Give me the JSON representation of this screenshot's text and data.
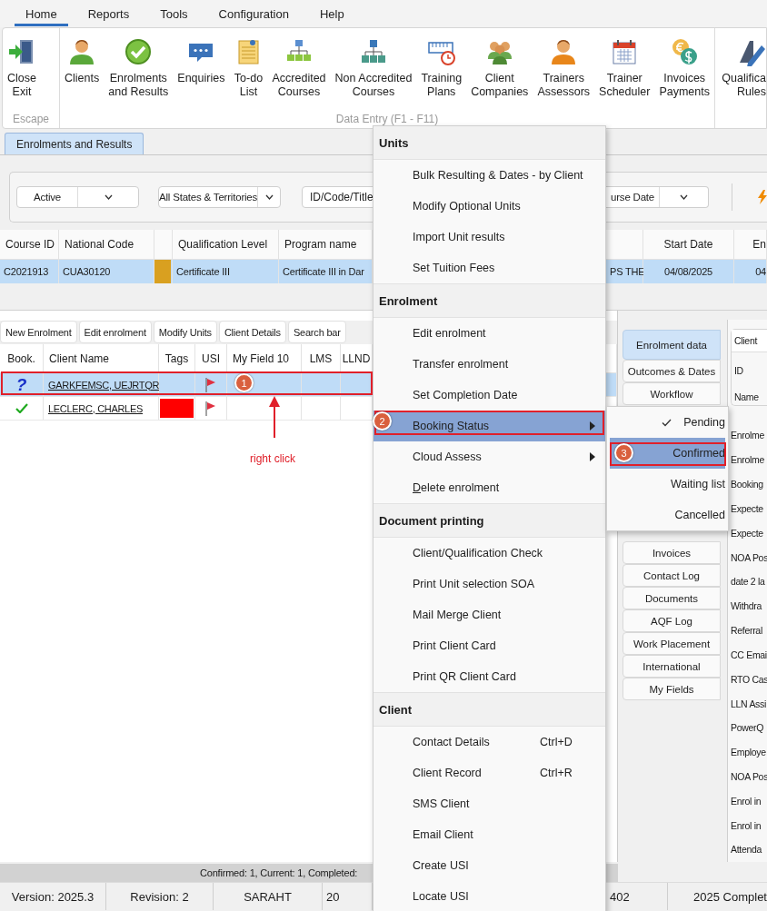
{
  "menu_bar": [
    {
      "label": "Home",
      "selected": true
    },
    {
      "label": "Reports",
      "selected": false
    },
    {
      "label": "Tools",
      "selected": false
    },
    {
      "label": "Configuration",
      "selected": false
    },
    {
      "label": "Help",
      "selected": false
    }
  ],
  "ribbon": {
    "groups": [
      {
        "label": "Escape",
        "buttons": [
          "Close\nExit"
        ]
      },
      {
        "label": "Data Entry (F1 - F11)",
        "buttons": [
          "Clients",
          "Enrolments\nand Results",
          "Enquiries",
          "To-do\nList",
          "Accredited\nCourses",
          "Non Accredited\nCourses",
          "Training\nPlans",
          "Client\nCompanies",
          "Trainers\nAssessors",
          "Trainer\nScheduler",
          "Invoices\nPayments"
        ]
      },
      {
        "buttons": [
          "Qualifica\nRules"
        ]
      }
    ]
  },
  "document_tabs": [
    {
      "label": "Enrolments and Results",
      "selected": true
    }
  ],
  "filters": {
    "status": "Active",
    "states": "All States & Territories",
    "placeholder": "ID/Code/Title",
    "date_sort": "urse Date"
  },
  "course_grid": {
    "columns": [
      "Course ID",
      "National Code",
      "Qualification Level",
      "Program name",
      "Start Date",
      "En"
    ],
    "rows": [
      {
        "course_id": "C2021913",
        "national_code": "CUA30120",
        "color": "#d9a020",
        "qualification_level": "Certificate III",
        "program_name": "Certificate III in Dar",
        "column_7": "PS THE",
        "start_date": "04/08/2025",
        "column_9": "04",
        "selected": true
      }
    ]
  },
  "enrolments": {
    "toolbar": [
      "New Enrolment",
      "Edit enrolment",
      "Modify Units",
      "Client Details",
      "Search bar"
    ],
    "columns": [
      "Book.",
      "Client Name",
      "Tags",
      "USI",
      "My Field 10",
      "LMS",
      "LLND"
    ],
    "rows": [
      {
        "kind": "pending",
        "book": "?",
        "client_name": "GARKFEMSC, UEJRTQR",
        "usi_flag": true,
        "selected": true
      },
      {
        "kind": "confirmed",
        "client_name": "LECLERC, CHARLES",
        "color": "#ff0000",
        "usi_flag": true,
        "selected": false
      }
    ]
  },
  "side_tabs": [
    {
      "label": "Enrolment data",
      "selected": true
    },
    {
      "label": "Outcomes & Dates",
      "selected": false
    },
    {
      "label": "Workflow",
      "selected": false
    },
    {
      "label": "Invoices",
      "selected": false
    },
    {
      "label": "Contact Log",
      "selected": false
    },
    {
      "label": "Documents",
      "selected": false
    },
    {
      "label": "AQF Log",
      "selected": false
    },
    {
      "label": "Work Placement",
      "selected": false
    },
    {
      "label": "International",
      "selected": false
    },
    {
      "label": "My Fields",
      "selected": false
    }
  ],
  "details": {
    "group_title": "Client",
    "group_labels": [
      "ID",
      "Name"
    ],
    "labels": [
      "Enrolme",
      "Enrolme",
      "Booking",
      "Expecte",
      "Expecte",
      "NOA Pos",
      "date 2 la",
      "Withdra",
      "Referral",
      "CC Emai",
      "RTO Cas",
      "LLN Assi",
      "PowerQ",
      "Employe",
      "NOA Pos",
      "Enrol in",
      "Enrol in",
      "Attenda"
    ]
  },
  "summary": "Confirmed: 1, Current: 1, Completed:",
  "status_bar": [
    "Version: 2025.3",
    "Revision: 2",
    "SARAHT",
    "20",
    "402",
    "2025 Complet"
  ],
  "context_menu": {
    "sections": [
      {
        "title": "Units",
        "items": [
          {
            "label": "Bulk Resulting & Dates - by Client",
            "has_submenu": false,
            "selected": false
          },
          {
            "label": "Modify Optional Units",
            "has_submenu": false,
            "selected": false
          },
          {
            "label": "Import Unit results",
            "has_submenu": false,
            "selected": false
          },
          {
            "label": "Set Tuition Fees",
            "has_submenu": false,
            "selected": false
          }
        ]
      },
      {
        "title": "Enrolment",
        "items": [
          {
            "label": "Edit enrolment",
            "has_submenu": false,
            "selected": false
          },
          {
            "label": "Transfer enrolment",
            "has_submenu": false,
            "selected": false
          },
          {
            "label": "Set Completion Date",
            "has_submenu": false,
            "selected": false
          },
          {
            "label": "Booking Status",
            "has_submenu": true,
            "selected": true
          },
          {
            "label": "Cloud Assess",
            "has_submenu": true,
            "selected": false
          },
          {
            "label": "Delete enrolment",
            "has_submenu": false,
            "selected": false,
            "mnemonic": true
          }
        ]
      },
      {
        "title": "Document printing",
        "items": [
          {
            "label": "Client/Qualification Check",
            "has_submenu": false,
            "selected": false
          },
          {
            "label": "Print Unit selection SOA",
            "has_submenu": false,
            "selected": false
          },
          {
            "label": "Mail Merge Client",
            "has_submenu": false,
            "selected": false
          },
          {
            "label": "Print Client Card",
            "has_submenu": false,
            "selected": false
          },
          {
            "label": "Print QR Client Card",
            "has_submenu": false,
            "selected": false
          }
        ]
      },
      {
        "title": "Client",
        "items": [
          {
            "label": "Contact Details",
            "shortcut": "Ctrl+D",
            "has_submenu": false,
            "selected": false
          },
          {
            "label": "Client Record",
            "shortcut": "Ctrl+R",
            "has_submenu": false,
            "selected": false
          },
          {
            "label": "SMS Client",
            "has_submenu": false,
            "selected": false
          },
          {
            "label": "Email Client",
            "has_submenu": false,
            "selected": false
          },
          {
            "label": "Create USI",
            "has_submenu": false,
            "selected": false
          },
          {
            "label": "Locate USI",
            "has_submenu": false,
            "selected": false
          }
        ]
      }
    ]
  },
  "submenu": {
    "items": [
      {
        "label": "Pending",
        "checked": true,
        "selected": false
      },
      {
        "label": "Confirmed",
        "checked": false,
        "selected": true
      },
      {
        "label": "Waiting list",
        "checked": false,
        "selected": false
      },
      {
        "label": "Cancelled",
        "checked": false,
        "selected": false
      }
    ]
  },
  "annotations": [
    {
      "kind": "highlight"
    },
    {
      "kind": "step",
      "label": "1"
    },
    {
      "kind": "arrow"
    },
    {
      "kind": "note",
      "text": "right click"
    },
    {
      "kind": "highlight"
    },
    {
      "kind": "step",
      "label": "2"
    },
    {
      "kind": "highlight"
    },
    {
      "kind": "step",
      "label": "3"
    }
  ]
}
